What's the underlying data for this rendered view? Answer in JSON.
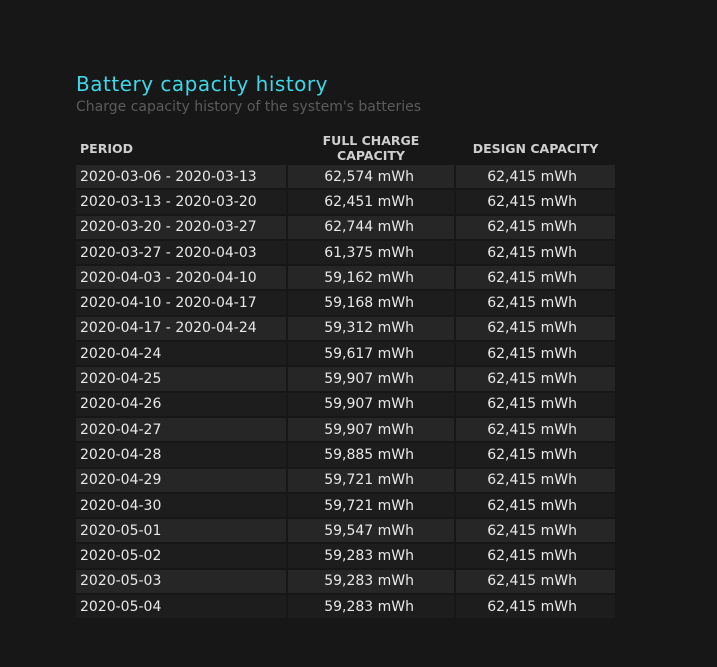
{
  "report": {
    "title": "Battery capacity history",
    "subtitle": "Charge capacity history of the system's batteries"
  },
  "table": {
    "headers": [
      "PERIOD",
      "FULL CHARGE CAPACITY",
      "DESIGN CAPACITY"
    ],
    "rows": [
      [
        "2020-03-06 - 2020-03-13",
        "62,574 mWh",
        "62,415 mWh"
      ],
      [
        "2020-03-13 - 2020-03-20",
        "62,451 mWh",
        "62,415 mWh"
      ],
      [
        "2020-03-20 - 2020-03-27",
        "62,744 mWh",
        "62,415 mWh"
      ],
      [
        "2020-03-27 - 2020-04-03",
        "61,375 mWh",
        "62,415 mWh"
      ],
      [
        "2020-04-03 - 2020-04-10",
        "59,162 mWh",
        "62,415 mWh"
      ],
      [
        "2020-04-10 - 2020-04-17",
        "59,168 mWh",
        "62,415 mWh"
      ],
      [
        "2020-04-17 - 2020-04-24",
        "59,312 mWh",
        "62,415 mWh"
      ],
      [
        "2020-04-24",
        "59,617 mWh",
        "62,415 mWh"
      ],
      [
        "2020-04-25",
        "59,907 mWh",
        "62,415 mWh"
      ],
      [
        "2020-04-26",
        "59,907 mWh",
        "62,415 mWh"
      ],
      [
        "2020-04-27",
        "59,907 mWh",
        "62,415 mWh"
      ],
      [
        "2020-04-28",
        "59,885 mWh",
        "62,415 mWh"
      ],
      [
        "2020-04-29",
        "59,721 mWh",
        "62,415 mWh"
      ],
      [
        "2020-04-30",
        "59,721 mWh",
        "62,415 mWh"
      ],
      [
        "2020-05-01",
        "59,547 mWh",
        "62,415 mWh"
      ],
      [
        "2020-05-02",
        "59,283 mWh",
        "62,415 mWh"
      ],
      [
        "2020-05-03",
        "59,283 mWh",
        "62,415 mWh"
      ],
      [
        "2020-05-04",
        "59,283 mWh",
        "62,415 mWh"
      ]
    ]
  },
  "colors": {
    "background": "#171717",
    "title": "#3fd6e6",
    "subtitle": "#5b5b5b",
    "row_odd": "#262626",
    "row_even": "#1d1d1d",
    "text": "#e8e8e8"
  }
}
